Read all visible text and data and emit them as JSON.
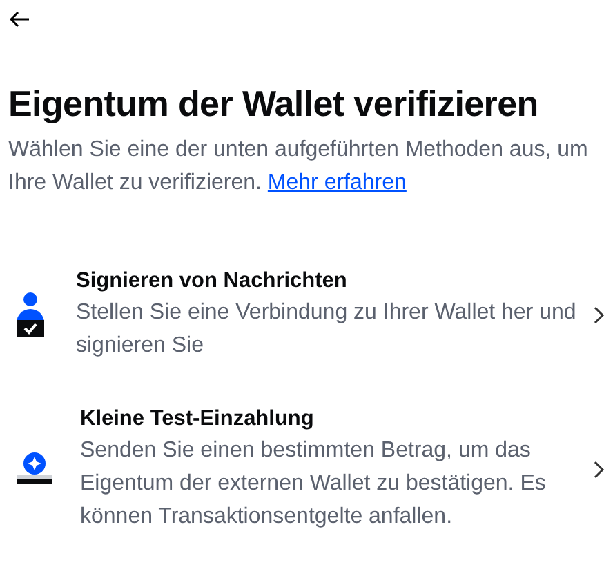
{
  "title": "Eigentum der Wallet verifizieren",
  "description": {
    "text": "Wählen Sie eine der unten aufgeführten Methoden aus, um Ihre Wallet zu verifizieren.",
    "link": "Mehr erfahren"
  },
  "methods": [
    {
      "kind": "sign",
      "title": "Signieren von Nachrichten",
      "text": "Stellen Sie eine Verbindung zu Ihrer Wallet her und signieren Sie"
    },
    {
      "kind": "deposit",
      "title": "Kleine Test-Einzahlung",
      "text": "Senden Sie einen bestimmten Betrag, um das Eigentum der externen Wallet zu bestätigen. Es können Transaktionsentgelte anfallen."
    }
  ]
}
